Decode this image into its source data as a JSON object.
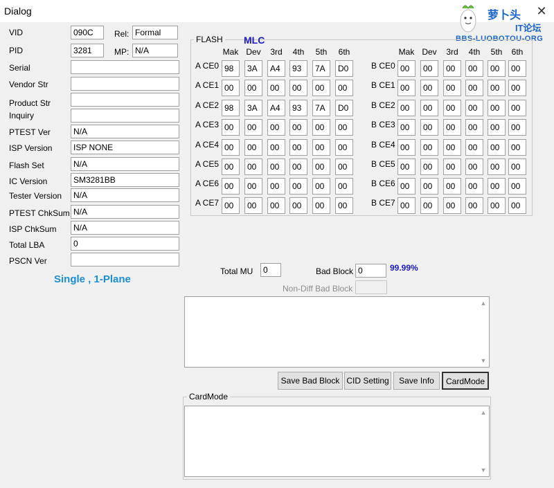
{
  "window": {
    "title": "Dialog",
    "close_glyph": "✕"
  },
  "logo": {
    "main": "萝卜头",
    "sub": "IT论坛",
    "url": "BBS-LUOBOTOU-ORG"
  },
  "info": {
    "vid_label": "VID",
    "vid": "090C",
    "rel_label": "Rel:",
    "rel": "Formal",
    "pid_label": "PID",
    "pid": "3281",
    "mp_label": "MP:",
    "mp": "N/A",
    "serial_label": "Serial",
    "serial": "",
    "vendor_label": "Vendor Str",
    "vendor": "",
    "product_label": "Product Str",
    "product": "",
    "inquiry_label": "Inquiry",
    "inquiry": "",
    "ptest_ver_label": "PTEST Ver",
    "ptest_ver": "N/A",
    "isp_version_label": "ISP Version",
    "isp_version": "ISP NONE",
    "flash_set_label": "Flash Set",
    "flash_set": "N/A",
    "ic_version_label": "IC Version",
    "ic_version": "SM3281BB",
    "tester_version_label": "Tester Version",
    "tester_version": "N/A",
    "ptest_chksum_label": "PTEST ChkSum",
    "ptest_chksum": "N/A",
    "isp_chksum_label": "ISP ChkSum",
    "isp_chksum": "N/A",
    "total_lba_label": "Total LBA",
    "total_lba": "0",
    "pscn_label": "PSCN Ver",
    "pscn": ""
  },
  "mode_text": "Single , 1-Plane",
  "flash": {
    "group_label": "FLASH",
    "type": "MLC",
    "columns": [
      "Mak",
      "Dev",
      "3rd",
      "4th",
      "5th",
      "6th"
    ],
    "a_rows": [
      {
        "label": "A CE0",
        "values": [
          "98",
          "3A",
          "A4",
          "93",
          "7A",
          "D0"
        ]
      },
      {
        "label": "A CE1",
        "values": [
          "00",
          "00",
          "00",
          "00",
          "00",
          "00"
        ]
      },
      {
        "label": "A CE2",
        "values": [
          "98",
          "3A",
          "A4",
          "93",
          "7A",
          "D0"
        ]
      },
      {
        "label": "A CE3",
        "values": [
          "00",
          "00",
          "00",
          "00",
          "00",
          "00"
        ]
      },
      {
        "label": "A CE4",
        "values": [
          "00",
          "00",
          "00",
          "00",
          "00",
          "00"
        ]
      },
      {
        "label": "A CE5",
        "values": [
          "00",
          "00",
          "00",
          "00",
          "00",
          "00"
        ]
      },
      {
        "label": "A CE6",
        "values": [
          "00",
          "00",
          "00",
          "00",
          "00",
          "00"
        ]
      },
      {
        "label": "A CE7",
        "values": [
          "00",
          "00",
          "00",
          "00",
          "00",
          "00"
        ]
      }
    ],
    "b_rows": [
      {
        "label": "B CE0",
        "values": [
          "00",
          "00",
          "00",
          "00",
          "00",
          "00"
        ]
      },
      {
        "label": "B CE1",
        "values": [
          "00",
          "00",
          "00",
          "00",
          "00",
          "00"
        ]
      },
      {
        "label": "B CE2",
        "values": [
          "00",
          "00",
          "00",
          "00",
          "00",
          "00"
        ]
      },
      {
        "label": "B CE3",
        "values": [
          "00",
          "00",
          "00",
          "00",
          "00",
          "00"
        ]
      },
      {
        "label": "B CE4",
        "values": [
          "00",
          "00",
          "00",
          "00",
          "00",
          "00"
        ]
      },
      {
        "label": "B CE5",
        "values": [
          "00",
          "00",
          "00",
          "00",
          "00",
          "00"
        ]
      },
      {
        "label": "B CE6",
        "values": [
          "00",
          "00",
          "00",
          "00",
          "00",
          "00"
        ]
      },
      {
        "label": "B CE7",
        "values": [
          "00",
          "00",
          "00",
          "00",
          "00",
          "00"
        ]
      }
    ]
  },
  "stats": {
    "total_mu_label": "Total MU",
    "total_mu": "0",
    "bad_block_label": "Bad Block",
    "bad_block": "0",
    "percent": "99.99%",
    "non_diff_label": "Non-Diff Bad Block",
    "non_diff": ""
  },
  "buttons": {
    "save_bad_block": "Save Bad Block",
    "cid_setting": "CID Setting",
    "save_info": "Save Info",
    "card_mode": "CardMode"
  },
  "cardmode_group_label": "CardMode",
  "colors": {
    "mode_text": "#1a8fd6",
    "mlc": "#1a1acc",
    "percent": "#1a1acc",
    "disabled": "#8c8c8c"
  },
  "icons": {
    "close": "close-icon",
    "scroll_up": "scroll-up-icon",
    "scroll_down": "scroll-down-icon",
    "mascot": "radish-mascot-icon"
  }
}
